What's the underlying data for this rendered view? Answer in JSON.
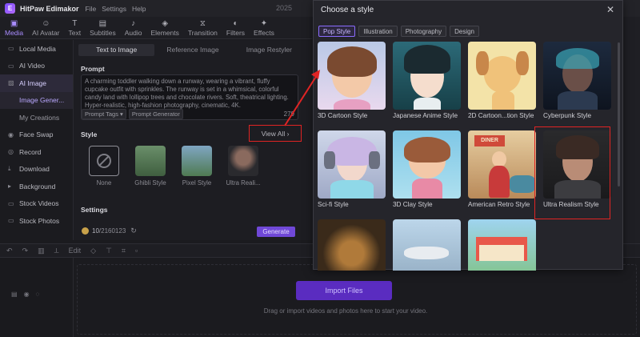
{
  "app": {
    "name": "HitPaw Edimakor",
    "menu": [
      "File",
      "Settings",
      "Help"
    ],
    "bg_year": "2025"
  },
  "toolbar": [
    "Media",
    "AI Avatar",
    "Text",
    "Subtitles",
    "Audio",
    "Elements",
    "Transition",
    "Filters",
    "Effects"
  ],
  "sidebar": {
    "items": [
      {
        "label": "Local Media"
      },
      {
        "label": "AI Video"
      },
      {
        "label": "AI Image"
      },
      {
        "label": "Image Gener..."
      },
      {
        "label": "My Creations"
      },
      {
        "label": "Face Swap"
      },
      {
        "label": "Record"
      },
      {
        "label": "Download"
      },
      {
        "label": "Background"
      },
      {
        "label": "Stock Videos"
      },
      {
        "label": "Stock Photos"
      }
    ]
  },
  "main": {
    "tabs": [
      "Text to Image",
      "Reference Image",
      "Image Restyler"
    ],
    "prompt_label": "Prompt",
    "prompt_text": "A charming toddler walking down a runway, wearing a vibrant, fluffy cupcake outfit with sprinkles. The runway is set in a whimsical, colorful candy land with lollipop trees and chocolate rivers. Soft, theatrical lighting. Hyper-realistic, high-fashion photography, cinematic, 4K.",
    "prompt_tags": "Prompt Tags",
    "prompt_generator": "Prompt Generator",
    "char_count": "279",
    "style_label": "Style",
    "view_all": "View All",
    "styles": [
      "None",
      "Ghibli Style",
      "Pixel Style",
      "Ultra Reali..."
    ],
    "settings_label": "Settings",
    "credits_num": "10",
    "credits_total": "/2160123",
    "generate": "Generate"
  },
  "timeline": {
    "tools": [
      "Edit"
    ],
    "import_button": "Import Files",
    "drop_hint": "Drag or import videos and photos here to start your video."
  },
  "modal": {
    "title": "Choose a style",
    "filters": [
      "Pop Style",
      "Illustration",
      "Photography",
      "Design"
    ],
    "active_filter": "Pop Style",
    "cards": [
      {
        "name": "3D Cartoon Style"
      },
      {
        "name": "Japanese Anime Style"
      },
      {
        "name": "2D Cartoon...tion Style"
      },
      {
        "name": "Cyberpunk Style"
      },
      {
        "name": "Sci-fi Style"
      },
      {
        "name": "3D Clay Style"
      },
      {
        "name": "American Retro Style"
      },
      {
        "name": "Ultra Realism Style"
      }
    ],
    "retro_sign": "DINER",
    "selected": "Ultra Realism Style"
  },
  "colors": {
    "accent": "#7048d8",
    "highlight": "#e02424"
  }
}
